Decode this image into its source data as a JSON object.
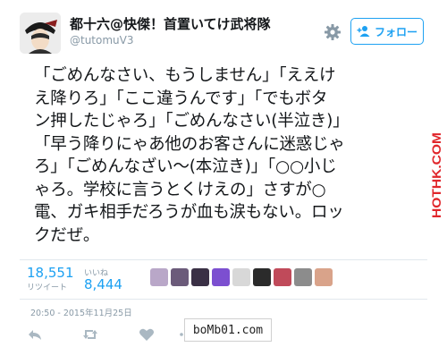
{
  "header": {
    "display_name": "都十六@快傑！首置いてけ武将隊",
    "handle": "@tutomuV3",
    "follow_label": "フォロー"
  },
  "tweet": {
    "lines": [
      "「ごめんなさい、もうしません」「ええけ",
      "え降りろ」「ここ違うんです」「でもボタ",
      "ン押したじゃろ」「ごめんなさい(半泣き)」",
      "「早う降りにゃあ他のお客さんに迷惑じゃ",
      "ろ」「ごめんなざい〜(本泣き)」「○○小じ",
      "ゃろ。学校に言うとくけえの」さすが○",
      "電、ガキ相手だろうが血も涙もない。ロッ",
      "クだぜ。"
    ]
  },
  "stats": {
    "retweets_count": "18,551",
    "retweets_label": "リツイート",
    "likes_label": "いいね",
    "likes_count": "8,444"
  },
  "likers": [
    "#b9a7c8",
    "#6b5b7a",
    "#3a3045",
    "#7c4fd0",
    "#d8d8d8",
    "#2b2b2b",
    "#c04a5a",
    "#8c8c8c",
    "#d9a38a"
  ],
  "timestamp": "20:50 - 2015年11月25日",
  "side_watermark": "HOTHK.COM",
  "watermark": "boMb01.com",
  "colors": {
    "accent": "#1da1f2",
    "side_watermark": "#e0262b"
  }
}
